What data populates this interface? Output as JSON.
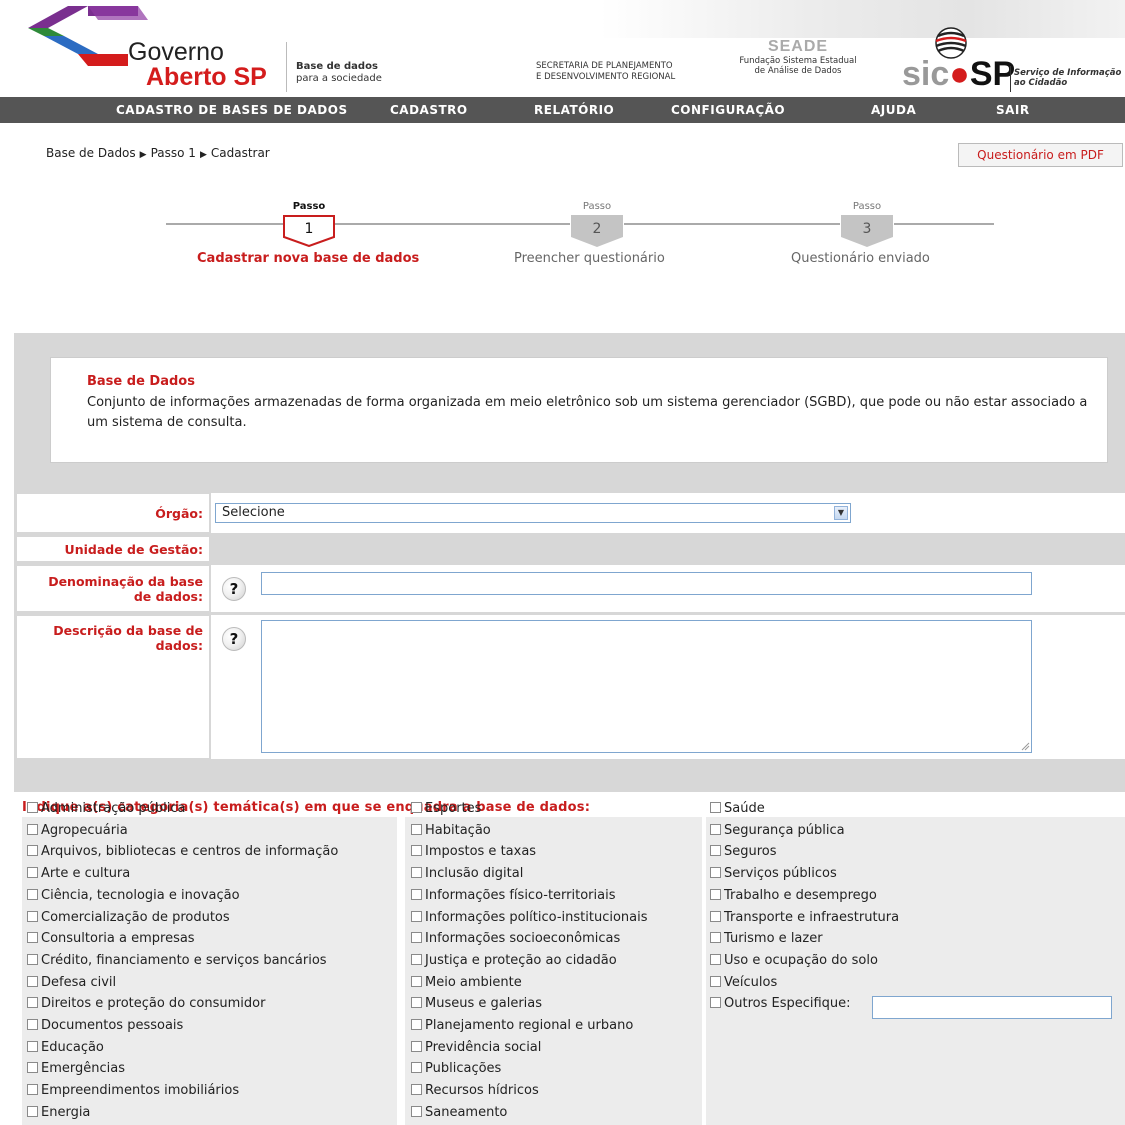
{
  "header": {
    "logo_line1": "Governo",
    "logo_line2": "Aberto SP",
    "tagline_1": "Base de dados",
    "tagline_2": "para a sociedade",
    "secretaria_1": "SECRETARIA DE PLANEJAMENTO",
    "secretaria_2": "E DESENVOLVIMENTO REGIONAL",
    "seade_name": "SEADE",
    "seade_sub_1": "Fundação Sistema Estadual",
    "seade_sub_2": "de Análise de Dados",
    "sic_a": "sic",
    "sic_b": "SP",
    "sic_sub_1": "Serviço de Informação",
    "sic_sub_2": "ao Cidadão"
  },
  "nav": {
    "items": [
      "CADASTRO DE BASES DE DADOS",
      "CADASTRO",
      "RELATÓRIO",
      "CONFIGURAÇÃO",
      "AJUDA",
      "SAIR"
    ]
  },
  "breadcrumb": {
    "items": [
      "Base de Dados",
      "Passo 1",
      "Cadastrar"
    ]
  },
  "pdf_button": "Questionário em PDF",
  "steps": [
    {
      "top": "Passo",
      "num": "1",
      "label": "Cadastrar nova base de dados",
      "active": true
    },
    {
      "top": "Passo",
      "num": "2",
      "label": "Preencher questionário",
      "active": false
    },
    {
      "top": "Passo",
      "num": "3",
      "label": "Questionário enviado",
      "active": false
    }
  ],
  "info": {
    "title": "Base de Dados",
    "text": "Conjunto de informações armazenadas de forma organizada em meio eletrônico sob um sistema gerenciador (SGBD), que pode ou não estar associado a um sistema de consulta."
  },
  "form": {
    "orgao_label": "Órgão:",
    "orgao_value": "Selecione",
    "unidade_label": "Unidade de Gestão:",
    "denominacao_label_1": "Denominação da base",
    "denominacao_label_2": "de dados:",
    "descricao_label_1": "Descrição da base de",
    "descricao_label_2": "dados:",
    "help_glyph": "?"
  },
  "categories": {
    "heading": "Indique a(s) categoria(s) temática(s) em que se enquadra a base de dados:",
    "col1": [
      "Administração pública",
      "Agropecuária",
      "Arquivos, bibliotecas e centros de informação",
      "Arte e cultura",
      "Ciência, tecnologia e inovação",
      "Comercialização de produtos",
      "Consultoria a empresas",
      "Crédito, financiamento e serviços bancários",
      "Defesa civil",
      "Direitos e proteção do consumidor",
      "Documentos pessoais",
      "Educação",
      "Emergências",
      "Empreendimentos imobiliários",
      "Energia"
    ],
    "col2": [
      "Esportes",
      "Habitação",
      "Impostos e taxas",
      "Inclusão digital",
      "Informações físico-territoriais",
      "Informações político-institucionais",
      "Informações socioeconômicas",
      "Justiça e proteção ao cidadão",
      "Meio ambiente",
      "Museus e galerias",
      "Planejamento regional e urbano",
      "Previdência social",
      "Publicações",
      "Recursos hídricos",
      "Saneamento"
    ],
    "col3": [
      "Saúde",
      "Segurança pública",
      "Seguros",
      "Serviços públicos",
      "Trabalho e desemprego",
      "Transporte e infraestrutura",
      "Turismo e lazer",
      "Uso e ocupação do solo",
      "Veículos",
      "Outros Especifique:"
    ]
  },
  "colors": {
    "accent_red": "#c81d1d",
    "nav_bg": "#555555",
    "panel_gray": "#d7d7d7"
  },
  "icons": [
    "governo-aberto-logo",
    "sic-sp-globe-icon",
    "select-arrow-icon",
    "help-icon",
    "checkbox"
  ]
}
